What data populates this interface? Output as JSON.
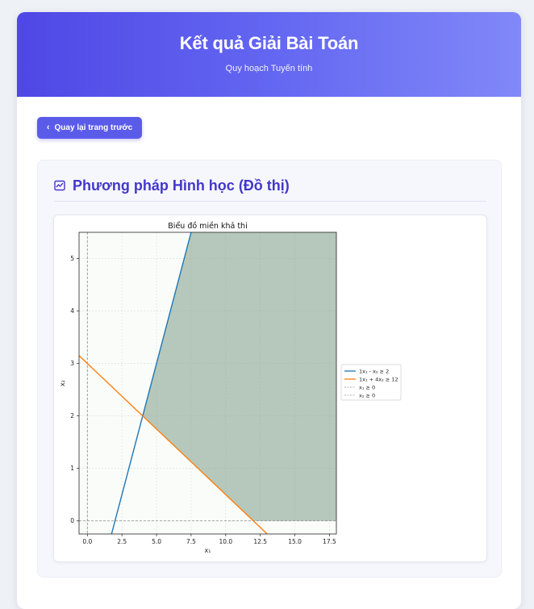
{
  "header": {
    "title": "Kết quả Giải Bài Toán",
    "subtitle": "Quy hoạch Tuyến tính"
  },
  "back_button": {
    "label": "Quay lại trang trước",
    "icon": "chevron-left-icon"
  },
  "section": {
    "title": "Phương pháp Hình học (Đồ thị)",
    "icon": "chart-icon",
    "accent_color": "#4338ca"
  },
  "chart_data": {
    "type": "line",
    "title": "Biểu đồ miền khả thi",
    "xlabel": "x₁",
    "ylabel": "x₂",
    "xlim": [
      -0.6,
      18.0
    ],
    "ylim": [
      -0.25,
      5.5
    ],
    "xticks": [
      "0.0",
      "2.5",
      "5.0",
      "7.5",
      "10.0",
      "12.5",
      "15.0",
      "17.5"
    ],
    "yticks": [
      "0",
      "1",
      "2",
      "3",
      "4",
      "5"
    ],
    "grid": true,
    "legend_position": "right",
    "series": [
      {
        "name": "1x₁ - x₂ ≥ 2",
        "color": "#1f77b4",
        "x": [
          1.75,
          7.5
        ],
        "y": [
          -0.25,
          5.5
        ]
      },
      {
        "name": "1x₁ + 4x₂ ≥ 12",
        "color": "#ff7f0e",
        "x": [
          -0.6,
          13.0
        ],
        "y": [
          3.15,
          -0.25
        ]
      },
      {
        "name": "x₁ ≥ 0",
        "color": "#999999",
        "style": "dashed"
      },
      {
        "name": "x₂ ≥ 0",
        "color": "#999999",
        "style": "dashed"
      }
    ],
    "feasible_region": {
      "color": "#8aa894",
      "vertices": [
        [
          4.0,
          2.0
        ],
        [
          7.5,
          5.5
        ],
        [
          18.0,
          5.5
        ],
        [
          18.0,
          0.0
        ],
        [
          12.0,
          0.0
        ]
      ]
    }
  }
}
